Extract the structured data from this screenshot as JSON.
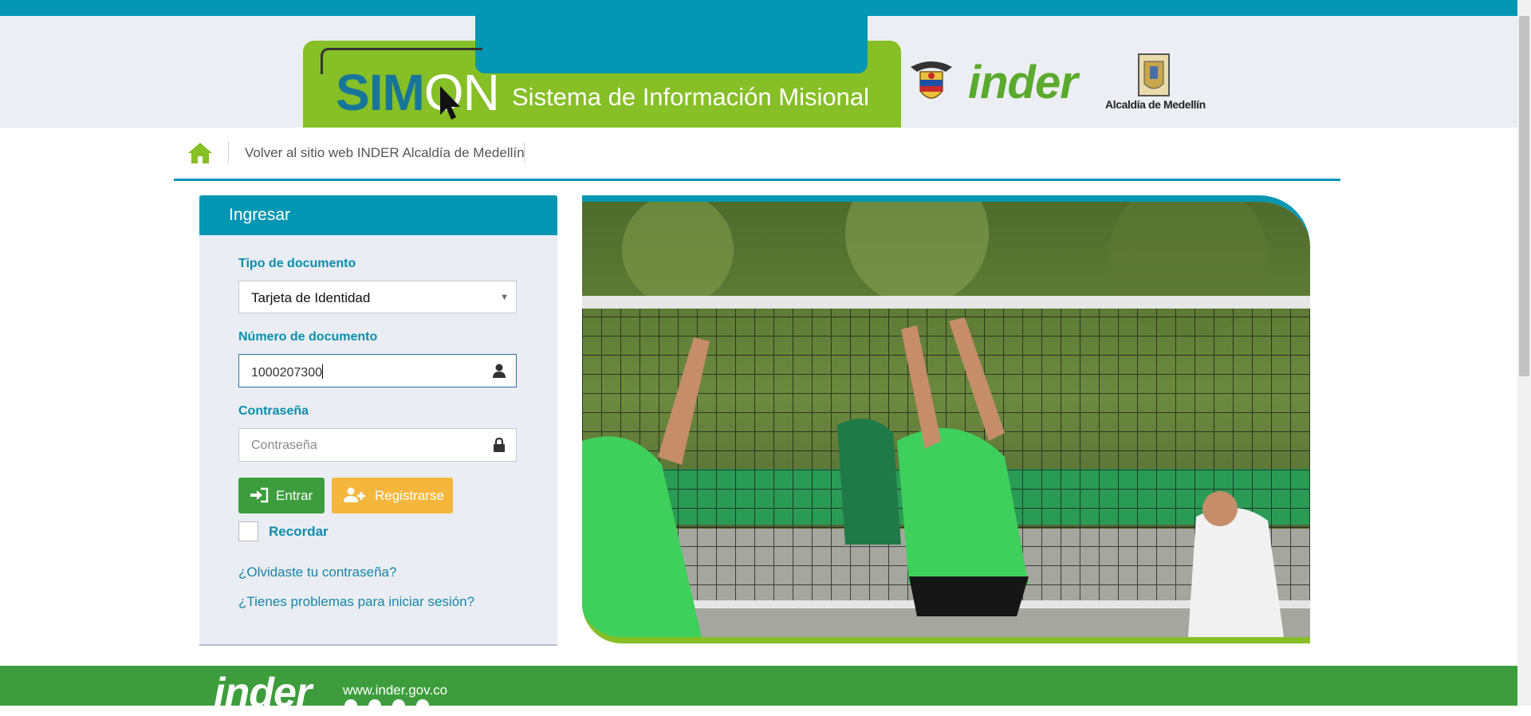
{
  "header": {
    "logo_prefix": "SIM",
    "logo_o": "O",
    "logo_suffix": "N",
    "subtitle": "Sistema de Información Misional",
    "inder_logo": "inder",
    "alcaldia_label": "Alcaldía de Medellín"
  },
  "nav": {
    "home_icon": "home-icon",
    "back_link": "Volver al sitio web INDER Alcaldía de Medellín"
  },
  "login": {
    "title": "Ingresar",
    "doc_type_label": "Tipo de documento",
    "doc_type_value": "Tarjeta de Identidad",
    "doc_number_label": "Número de documento",
    "doc_number_value": "1000207300",
    "password_label": "Contraseña",
    "password_placeholder": "Contraseña",
    "enter_button": "Entrar",
    "register_button": "Registrarse",
    "remember_label": "Recordar",
    "forgot_link": "¿Olvidaste tu contraseña?",
    "trouble_link": "¿Tienes problemas para iniciar sesión?"
  },
  "footer": {
    "logo": "inder",
    "url": "www.inder.gov.co"
  },
  "colors": {
    "primary_blue": "#0596b3",
    "brand_green": "#86bf26",
    "button_green": "#3d9d3d",
    "button_orange": "#f4b73c",
    "link_blue": "#1586a8"
  }
}
